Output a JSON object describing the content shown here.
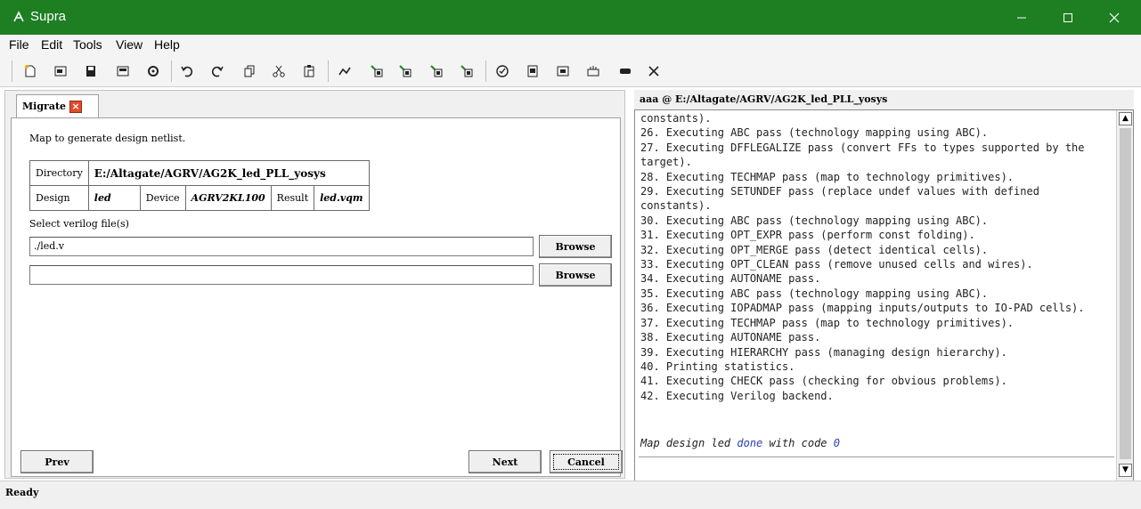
{
  "window": {
    "title": "Supra"
  },
  "menu": [
    "File",
    "Edit",
    "Tools",
    "View",
    "Help"
  ],
  "left": {
    "tab_label": "Migrate",
    "instruction": "Map to generate design netlist.",
    "table": {
      "directory_label": "Directory",
      "directory_value": "E:/Altagate/AGRV/AG2K_led_PLL_yosys",
      "design_label": "Design",
      "design_value": "led",
      "device_label": "Device",
      "device_value": "AGRV2KL100",
      "result_label": "Result",
      "result_value": "led.vqm"
    },
    "select_label": "Select verilog file(s)",
    "file1_value": "./led.v",
    "file2_value": "",
    "browse_label": "Browse",
    "prev_label": "Prev",
    "next_label": "Next",
    "cancel_label": "Cancel"
  },
  "right": {
    "title": "aaa @ E:/Altagate/AGRV/AG2K_led_PLL_yosys",
    "log": [
      "constants).",
      "26. Executing ABC pass (technology mapping using ABC).",
      "27. Executing DFFLEGALIZE pass (convert FFs to types supported by the",
      "target).",
      "28. Executing TECHMAP pass (map to technology primitives).",
      "29. Executing SETUNDEF pass (replace undef values with defined",
      "constants).",
      "30. Executing ABC pass (technology mapping using ABC).",
      "31. Executing OPT_EXPR pass (perform const folding).",
      "32. Executing OPT_MERGE pass (detect identical cells).",
      "33. Executing OPT_CLEAN pass (remove unused cells and wires).",
      "34. Executing AUTONAME pass.",
      "35. Executing ABC pass (technology mapping using ABC).",
      "36. Executing IOPADMAP pass (mapping inputs/outputs to IO-PAD cells).",
      "37. Executing TECHMAP pass (map to technology primitives).",
      "38. Executing AUTONAME pass.",
      "39. Executing HIERARCHY pass (managing design hierarchy).",
      "40. Printing statistics.",
      "41. Executing CHECK pass (checking for obvious problems).",
      "42. Executing Verilog backend."
    ],
    "done": {
      "pre": "Map design led ",
      "kw": "done",
      "mid": " with code ",
      "code": "0"
    }
  },
  "status": {
    "text": "Ready"
  },
  "colors": {
    "titlebar": "#1e7e22",
    "close_tab": "#e04b2b",
    "keyword": "#2a3fb0"
  },
  "toolbar_icons": [
    "new-icon",
    "open-icon",
    "save-icon",
    "save-as-icon",
    "settings-icon",
    "undo-icon",
    "redo-icon",
    "copy-icon",
    "cut-icon",
    "paste-icon",
    "flow-icon",
    "step1-icon",
    "step2-icon",
    "step3-icon",
    "step4-icon",
    "check-icon",
    "report-icon",
    "view-icon",
    "program-icon",
    "chip-icon",
    "close-icon"
  ]
}
